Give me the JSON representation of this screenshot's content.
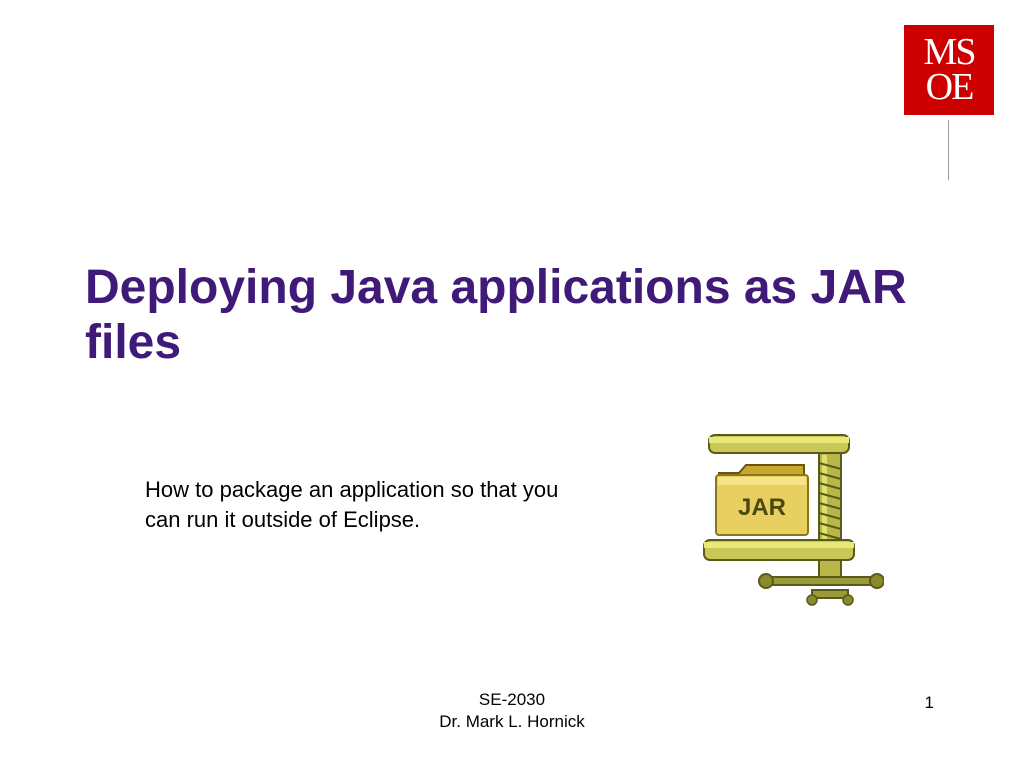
{
  "logo": {
    "line1": "MS",
    "line2": "OE"
  },
  "title": "Deploying Java applications as JAR files",
  "subtitle": "How to package an application so that you can run it outside of Eclipse.",
  "jar_label": "JAR",
  "footer": {
    "course": "SE-2030",
    "author": "Dr. Mark L. Hornick",
    "page": "1"
  }
}
